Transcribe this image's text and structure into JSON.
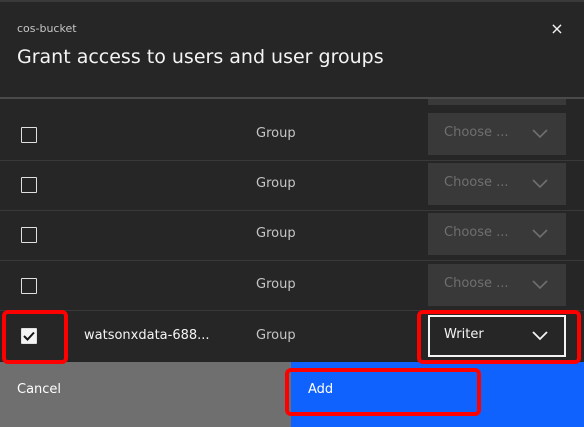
{
  "modal": {
    "eyebrow": "cos-bucket",
    "title": "Grant access to users and user groups",
    "close_glyph": "×"
  },
  "rows": [
    {
      "name": "",
      "type": "Group",
      "role": "Choose ...",
      "checked": false
    },
    {
      "name": "",
      "type": "Group",
      "role": "Choose ...",
      "checked": false
    },
    {
      "name": "",
      "type": "Group",
      "role": "Choose ...",
      "checked": false
    },
    {
      "name": "",
      "type": "Group",
      "role": "Choose ...",
      "checked": false
    },
    {
      "name": "watsonxdata-688...",
      "type": "Group",
      "role": "Writer",
      "checked": true
    }
  ],
  "footer": {
    "cancel_label": "Cancel",
    "add_label": "Add"
  },
  "colors": {
    "primary": "#0f62fe",
    "secondary": "#6f6f6f",
    "highlight": "#ff0000"
  },
  "icons": [
    "close-icon",
    "checkbox-icon",
    "checkmark-icon",
    "chevron-down-icon"
  ]
}
